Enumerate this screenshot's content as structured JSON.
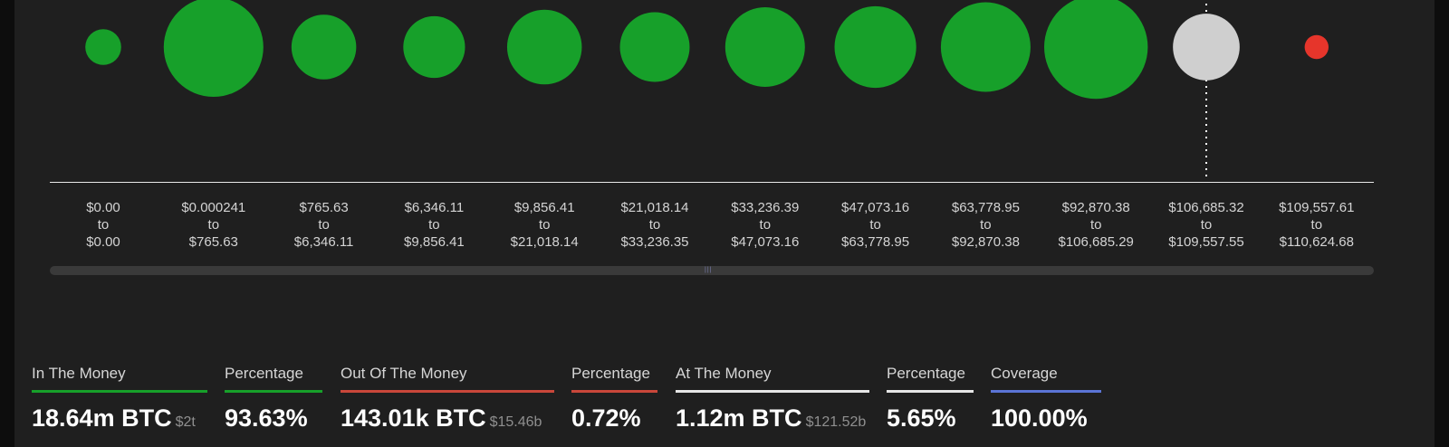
{
  "chart_data": {
    "type": "scatter",
    "title": "",
    "xlabel": "",
    "ylabel": "",
    "categories": [
      {
        "from": "$0.00",
        "to": "$0.00",
        "status": "in"
      },
      {
        "from": "$0.000241",
        "to": "$765.63",
        "status": "in"
      },
      {
        "from": "$765.63",
        "to": "$6,346.11",
        "status": "in"
      },
      {
        "from": "$6,346.11",
        "to": "$9,856.41",
        "status": "in"
      },
      {
        "from": "$9,856.41",
        "to": "$21,018.14",
        "status": "in"
      },
      {
        "from": "$21,018.14",
        "to": "$33,236.35",
        "status": "in"
      },
      {
        "from": "$33,236.39",
        "to": "$47,073.16",
        "status": "in"
      },
      {
        "from": "$47,073.16",
        "to": "$63,778.95",
        "status": "in"
      },
      {
        "from": "$63,778.95",
        "to": "$92,870.38",
        "status": "in"
      },
      {
        "from": "$92,870.38",
        "to": "$106,685.29",
        "status": "in"
      },
      {
        "from": "$106,685.32",
        "to": "$109,557.55",
        "status": "at"
      },
      {
        "from": "$109,557.61",
        "to": "$110,624.68",
        "status": "out"
      }
    ],
    "connector": "to",
    "bubble_relative_size": [
      0.36,
      1.0,
      0.65,
      0.62,
      0.75,
      0.7,
      0.8,
      0.82,
      0.9,
      1.04,
      0.67,
      0.24
    ],
    "current_price_marker_index": 10,
    "colors": {
      "in": "#17a02a",
      "at": "#cfcfcf",
      "out": "#e6352b"
    }
  },
  "stats": [
    {
      "label": "In The Money",
      "value": "18.64m BTC",
      "sub": "$2t",
      "color": "#17a02a"
    },
    {
      "label": "Percentage",
      "value": "93.63%",
      "sub": "",
      "color": "#17a02a"
    },
    {
      "label": "Out Of The Money",
      "value": "143.01k BTC",
      "sub": "$15.46b",
      "color": "#c9473a"
    },
    {
      "label": "Percentage",
      "value": "0.72%",
      "sub": "",
      "color": "#c9473a"
    },
    {
      "label": "At The Money",
      "value": "1.12m BTC",
      "sub": "$121.52b",
      "color": "#e6e6e6"
    },
    {
      "label": "Percentage",
      "value": "5.65%",
      "sub": "",
      "color": "#e6e6e6"
    },
    {
      "label": "Coverage",
      "value": "100.00%",
      "sub": "",
      "color": "#5b74d6"
    }
  ],
  "scrollbar": {
    "grip": "|||"
  }
}
